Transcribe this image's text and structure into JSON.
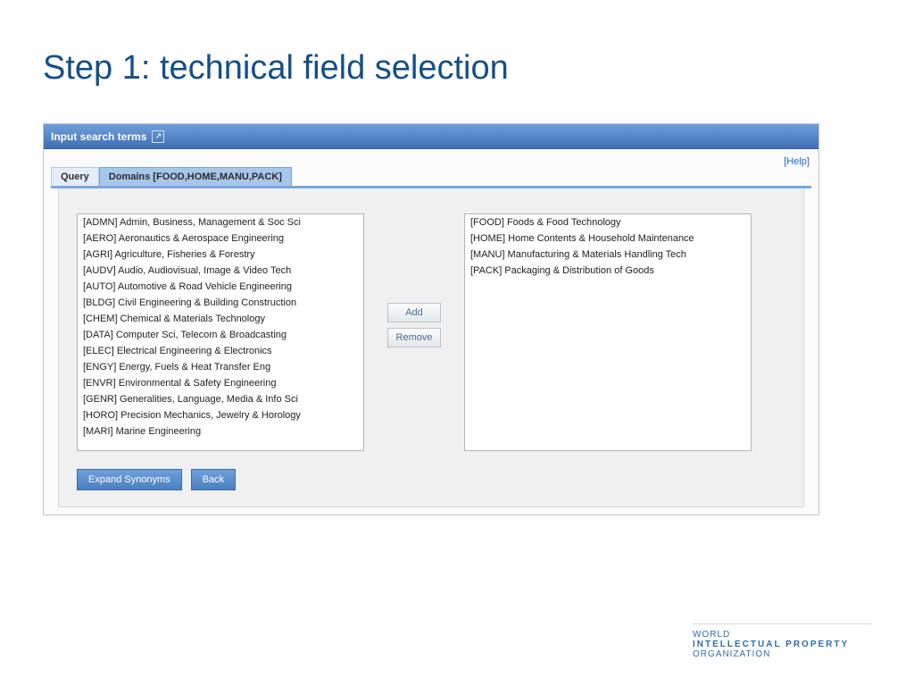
{
  "title": "Step 1: technical field selection",
  "panel": {
    "header": "Input search terms",
    "help": "[Help]"
  },
  "tabs": {
    "query": "Query",
    "domains": "Domains [FOOD,HOME,MANU,PACK]"
  },
  "available": [
    "[ADMN] Admin, Business, Management & Soc Sci",
    "[AERO] Aeronautics & Aerospace Engineering",
    "[AGRI] Agriculture, Fisheries & Forestry",
    "[AUDV] Audio, Audiovisual, Image & Video Tech",
    "[AUTO] Automotive & Road Vehicle Engineering",
    "[BLDG] Civil Engineering & Building Construction",
    "[CHEM] Chemical & Materials Technology",
    "[DATA] Computer Sci, Telecom & Broadcasting",
    "[ELEC] Electrical Engineering & Electronics",
    "[ENGY] Energy, Fuels & Heat Transfer Eng",
    "[ENVR] Environmental & Safety Engineering",
    "[GENR] Generalities, Language, Media & Info Sci",
    "[HORO] Precision Mechanics, Jewelry & Horology",
    "[MARI] Marine Engineering"
  ],
  "selected": [
    "[FOOD] Foods & Food Technology",
    "[HOME] Home Contents & Household Maintenance",
    "[MANU] Manufacturing & Materials Handling Tech",
    "[PACK] Packaging & Distribution of Goods"
  ],
  "buttons": {
    "add": "Add",
    "remove": "Remove",
    "expand": "Expand Synonyms",
    "back": "Back"
  },
  "brand": {
    "l1": "WORLD",
    "l2": "INTELLECTUAL PROPERTY",
    "l3": "ORGANIZATION"
  }
}
